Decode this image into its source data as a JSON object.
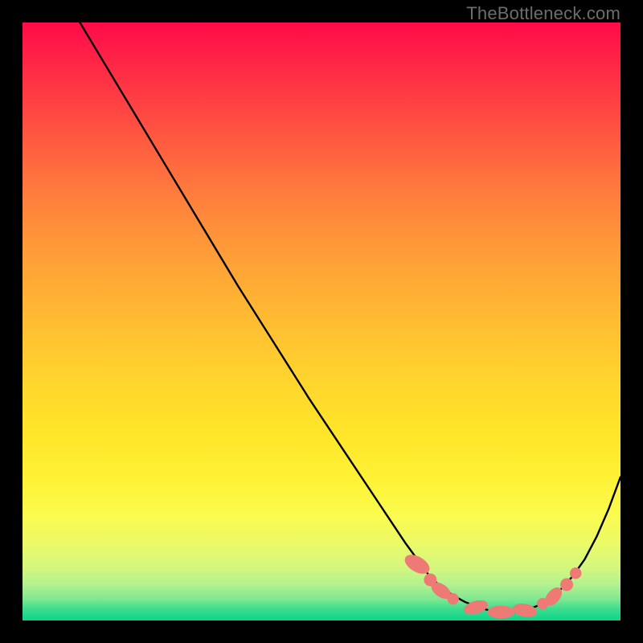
{
  "watermark": "TheBottleneck.com",
  "colors": {
    "background": "#000000",
    "curve": "#000000",
    "marker_fill": "#ed7a74",
    "marker_stroke": "#ed7a74"
  },
  "chart_data": {
    "type": "line",
    "title": "",
    "xlabel": "",
    "ylabel": "",
    "xlim": [
      0,
      100
    ],
    "ylim": [
      0,
      100
    ],
    "grid": false,
    "legend": false,
    "series": [
      {
        "name": "bottleneck-curve",
        "x": [
          0,
          6,
          12,
          18,
          24,
          30,
          36,
          42,
          48,
          54,
          60,
          64,
          68,
          70,
          72,
          74,
          76,
          78,
          80,
          82,
          84,
          86,
          88,
          90,
          92,
          94,
          96,
          98,
          100
        ],
        "values": [
          116,
          106,
          96,
          86,
          76,
          66,
          56,
          46.5,
          37,
          28,
          19,
          13,
          7.5,
          5.6,
          4.2,
          3.1,
          2.3,
          1.7,
          1.4,
          1.4,
          1.7,
          2.4,
          3.6,
          5.2,
          7.4,
          10.2,
          14.0,
          18.6,
          24.0
        ]
      }
    ],
    "markers": [
      {
        "shape": "ellipse",
        "cx": 66.0,
        "cy": 9.4,
        "rx": 1.2,
        "ry": 2.2,
        "angle": -60
      },
      {
        "shape": "circle",
        "cx": 68.2,
        "cy": 6.8,
        "r": 1.0
      },
      {
        "shape": "ellipse",
        "cx": 70.0,
        "cy": 5.0,
        "rx": 1.0,
        "ry": 1.8,
        "angle": -55
      },
      {
        "shape": "circle",
        "cx": 72.0,
        "cy": 3.6,
        "r": 0.9
      },
      {
        "shape": "ellipse",
        "cx": 75.8,
        "cy": 2.2,
        "rx": 2.0,
        "ry": 1.0,
        "angle": -16
      },
      {
        "shape": "ellipse",
        "cx": 80.0,
        "cy": 1.4,
        "rx": 2.2,
        "ry": 1.0,
        "angle": 0
      },
      {
        "shape": "ellipse",
        "cx": 84.0,
        "cy": 1.7,
        "rx": 2.0,
        "ry": 1.0,
        "angle": 10
      },
      {
        "shape": "circle",
        "cx": 87.0,
        "cy": 2.8,
        "r": 0.9
      },
      {
        "shape": "ellipse",
        "cx": 88.8,
        "cy": 4.0,
        "rx": 1.0,
        "ry": 1.7,
        "angle": 40
      },
      {
        "shape": "circle",
        "cx": 91.0,
        "cy": 6.0,
        "r": 1.0
      },
      {
        "shape": "circle",
        "cx": 92.5,
        "cy": 7.9,
        "r": 0.9
      }
    ]
  }
}
